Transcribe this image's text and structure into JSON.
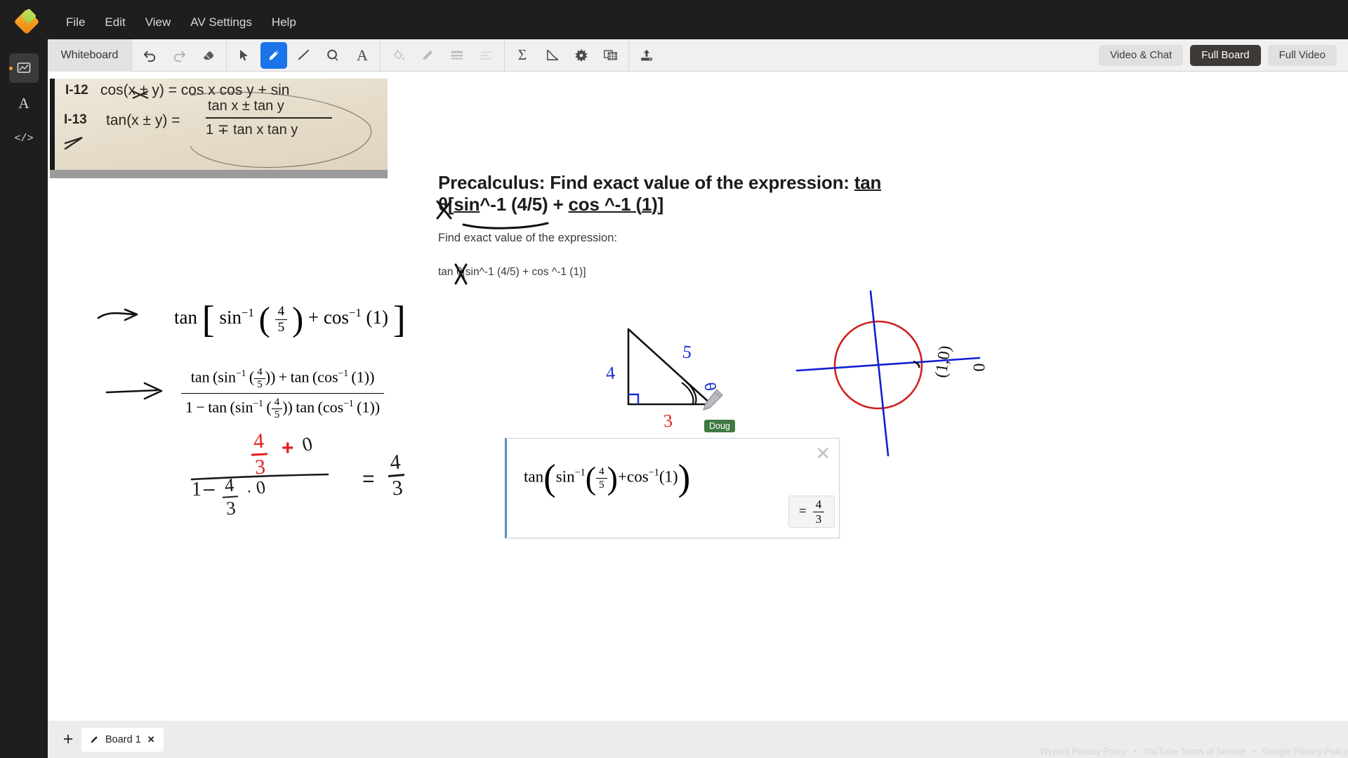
{
  "app": {
    "logo": "wyzant-diamond-logo",
    "menu": [
      "File",
      "Edit",
      "View",
      "AV Settings",
      "Help"
    ]
  },
  "rail": {
    "items": [
      {
        "name": "whiteboard-panel",
        "glyph": "◱",
        "active": true
      },
      {
        "name": "text-panel",
        "glyph": "A",
        "active": false
      },
      {
        "name": "code-panel",
        "glyph": "</>",
        "active": false
      }
    ]
  },
  "toolbar": {
    "whiteboard_label": "Whiteboard",
    "groups": [
      {
        "name": "history",
        "tools": [
          {
            "name": "undo-button",
            "icon": "undo-icon",
            "state": "enabled"
          },
          {
            "name": "redo-button",
            "icon": "redo-icon",
            "state": "disabled"
          },
          {
            "name": "eraser-button",
            "icon": "eraser-icon",
            "state": "enabled"
          }
        ]
      },
      {
        "name": "draw",
        "tools": [
          {
            "name": "select-tool",
            "icon": "cursor-arrow-icon",
            "state": "enabled"
          },
          {
            "name": "pen-tool",
            "icon": "pencil-icon",
            "state": "selected"
          },
          {
            "name": "line-tool",
            "icon": "line-icon",
            "state": "enabled"
          },
          {
            "name": "shape-tool",
            "icon": "circle-shape-icon",
            "state": "enabled"
          },
          {
            "name": "text-tool",
            "icon": "text-a-icon",
            "state": "enabled"
          }
        ]
      },
      {
        "name": "style",
        "tools": [
          {
            "name": "fill-color-tool",
            "icon": "paint-bucket-icon",
            "state": "disabled"
          },
          {
            "name": "stroke-color-tool",
            "icon": "marker-pen-icon",
            "state": "disabled"
          },
          {
            "name": "line-weight-tool",
            "icon": "line-weight-icon",
            "state": "disabled"
          },
          {
            "name": "line-style-tool",
            "icon": "dashed-lines-icon",
            "state": "disabled"
          }
        ]
      },
      {
        "name": "math",
        "tools": [
          {
            "name": "equation-tool",
            "icon": "sigma-icon",
            "state": "enabled"
          },
          {
            "name": "graph-tool",
            "icon": "graph-curve-icon",
            "state": "enabled"
          },
          {
            "name": "chemistry-tool",
            "icon": "gear-burst-icon",
            "state": "enabled"
          },
          {
            "name": "grid-tool",
            "icon": "table-grid-icon",
            "state": "enabled"
          }
        ]
      },
      {
        "name": "file",
        "tools": [
          {
            "name": "upload-button",
            "icon": "upload-icon",
            "state": "enabled"
          }
        ]
      }
    ],
    "right_buttons": [
      {
        "name": "video-and-chat-button",
        "label": "Video & Chat",
        "active": false
      },
      {
        "name": "full-board-button",
        "label": "Full Board",
        "active": true
      },
      {
        "name": "full-video-button",
        "label": "Full Video",
        "active": false
      }
    ]
  },
  "canvas": {
    "textbook_photo": {
      "line1_id": "I-12",
      "line1_text": "cos(x ± y) = cos x cos y + sin",
      "line2_id": "I-13",
      "line2_lhs": "tan(x ± y) =",
      "line2_num": "tan x ± tan y",
      "line2_den": "1 ∓ tan x tan y"
    },
    "step1": {
      "label": "tan",
      "inner_fn1": "sin",
      "inner_fn1_exp": "−1",
      "frac_num": "4",
      "frac_den": "5",
      "plus": "+",
      "inner_fn2": "cos",
      "inner_fn2_exp": "−1",
      "arg2": "(1)"
    },
    "step2": {
      "numerator": "tan (sin−1 (4/5)) + tan (cos−1 (1))",
      "denominator": "1 − tan (sin−1 (4/5)) tan (cos−1 (1))"
    },
    "step3_handwritten": {
      "num_frac_n": "4",
      "num_frac_d": "3",
      "num_plus": "+",
      "num_zero": "0",
      "den_one": "1",
      "den_minus": "–",
      "den_frac_n": "4",
      "den_frac_d": "3",
      "den_dot": "·",
      "den_zero": "0",
      "equals": "=",
      "result_n": "4",
      "result_d": "3",
      "red_color": "#e02020",
      "black_color": "#1a1a1a"
    },
    "triangle": {
      "side_vertical": "4",
      "side_hypotenuse": "5",
      "side_base": "3",
      "vertical_color": "#1a2fd0",
      "hypotenuse_color": "#1a2fd0",
      "base_color": "#e02020",
      "angle_marker": "theta-arc"
    },
    "unit_circle": {
      "circle_color": "#d02020",
      "axes_color": "#1020d0",
      "point_label": "(1,0)",
      "angle_label": "0"
    },
    "cursor": {
      "name": "Doug",
      "color": "#3f7a44"
    },
    "result_card": {
      "expression": {
        "fn": "tan",
        "inner1": "sin",
        "inner1_exp": "−1",
        "frac_n": "4",
        "frac_d": "5",
        "plus": "+",
        "inner2": "cos",
        "inner2_exp": "−1",
        "arg2": "(1)"
      },
      "result_equals": "=",
      "result_n": "4",
      "result_d": "3",
      "close_icon": "close-x-icon"
    }
  },
  "document": {
    "title_line1": "Precalculus: Find exact value of the expression: tan",
    "title_line2": "θ[sin^-1 (4/5) + cos ^-1 (1)]",
    "subtitle": "Find exact value of the expression:",
    "expression_text": "tan θ[sin^-1 (4/5) + cos ^-1 (1)]"
  },
  "bottom": {
    "add_board_icon": "plus-icon",
    "tabs": [
      {
        "name": "board-tab",
        "icon": "pencil-icon",
        "label": "Board 1",
        "close": "✕"
      }
    ],
    "footer_links": [
      "Wyzant Privacy Policy",
      "YouTube Terms of Service",
      "Google Privacy Policy"
    ],
    "footer_separator": "•"
  }
}
